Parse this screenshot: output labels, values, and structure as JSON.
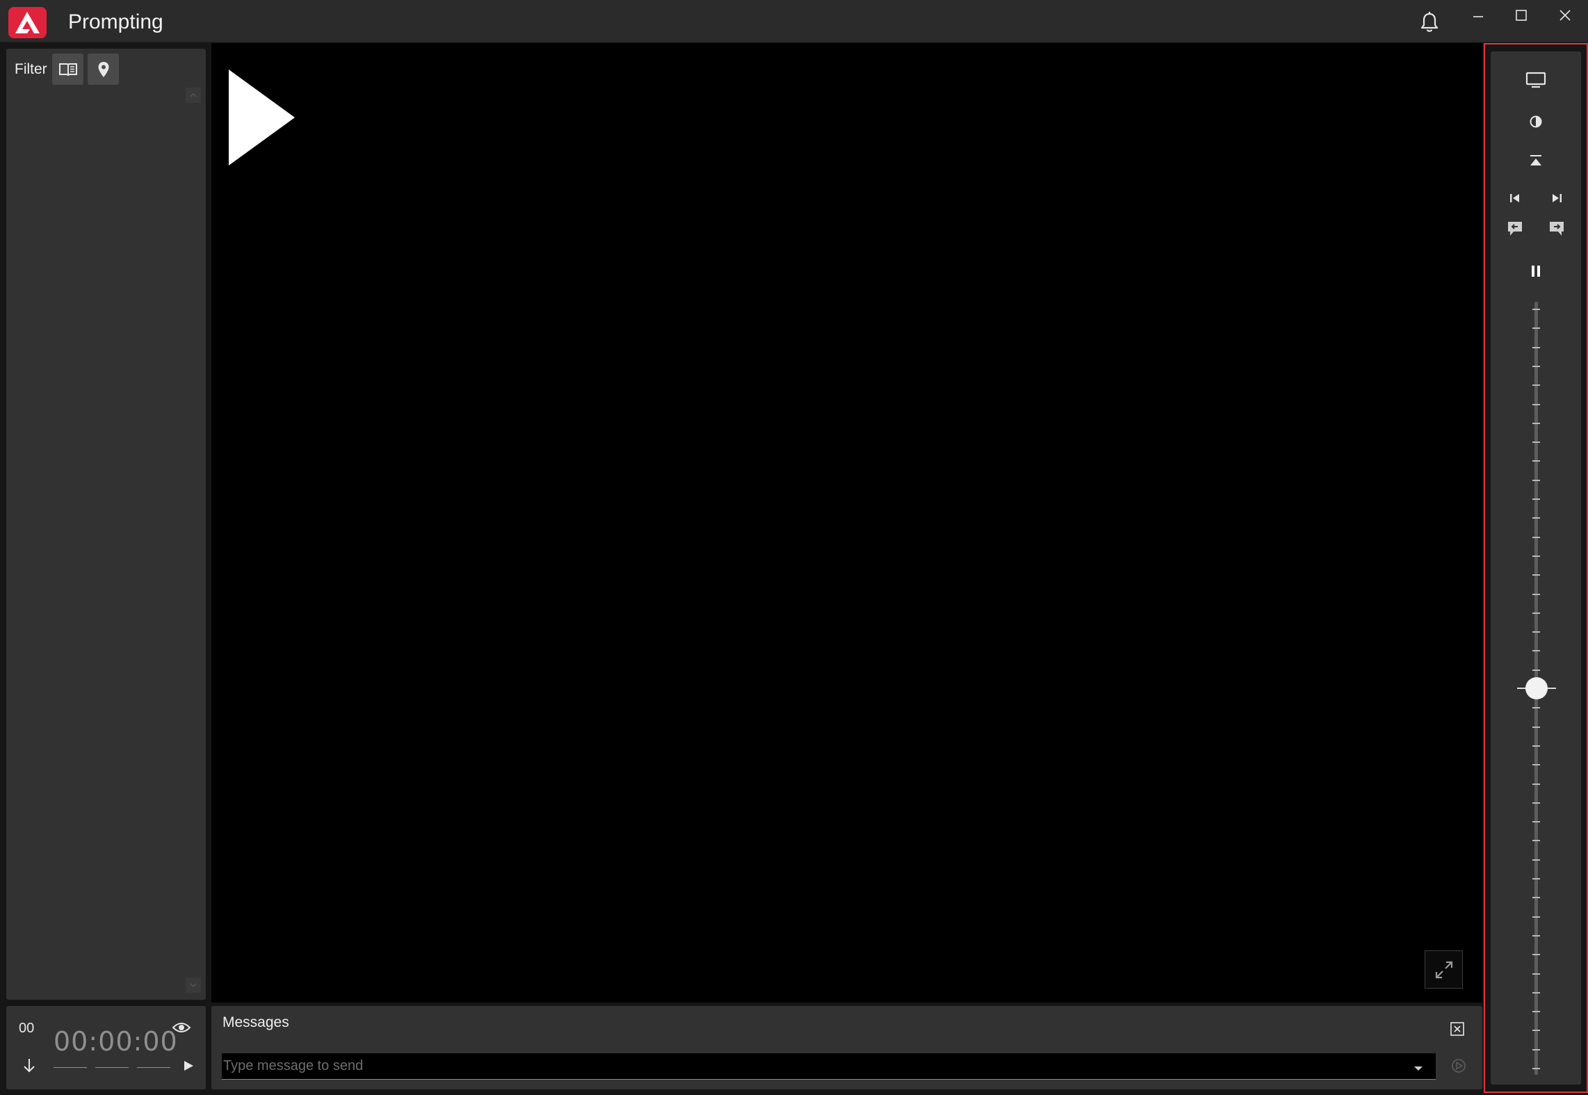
{
  "window": {
    "title": "Prompting",
    "accent_color": "#e0353c",
    "logo_color": "#e0233c"
  },
  "filter": {
    "label": "Filter",
    "buttons": [
      "book-icon",
      "map-pin-icon"
    ]
  },
  "timer": {
    "segment": "00",
    "time": "00:00:00"
  },
  "messages": {
    "title": "Messages",
    "placeholder": "Type message to send"
  },
  "controls": {
    "buttons": [
      "monitor-icon",
      "contrast-icon",
      "jump-to-top-icon",
      "skip-previous-icon",
      "skip-next-icon",
      "previous-marker-icon",
      "next-marker-icon",
      "pause-icon"
    ],
    "speed_level": 0.5
  }
}
